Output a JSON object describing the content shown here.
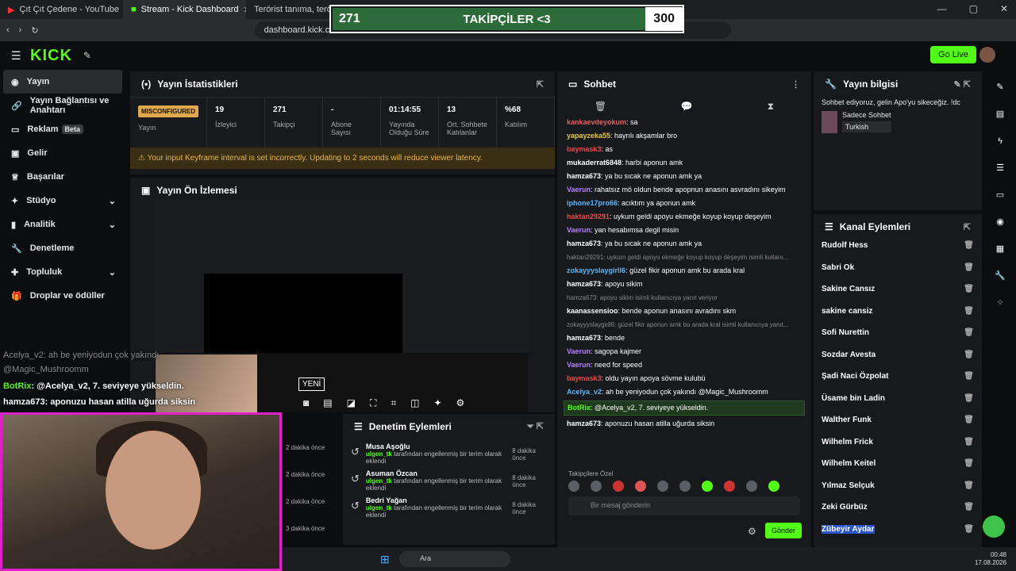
{
  "browser": {
    "tabs": [
      {
        "title": "Çıt Çıt Çedene - YouTube"
      },
      {
        "title": "Stream - Kick Dashboard"
      },
      {
        "title": "Terörist tanıma, terörist ta..."
      }
    ],
    "url": "dashboard.kick.com/str"
  },
  "overlay": {
    "current": "271",
    "label": "TAKİPÇİLER <3",
    "goal": "300",
    "progress": 0.9033
  },
  "header": {
    "logo": "KICK",
    "go_live": "Go Live"
  },
  "sidebar": {
    "items": [
      {
        "label": "Yayın"
      },
      {
        "label": "Yayın Bağlantısı ve Anahtarı"
      },
      {
        "label": "Reklam"
      },
      {
        "label": "Gelir"
      },
      {
        "label": "Başarılar"
      },
      {
        "label": "Stüdyo"
      },
      {
        "label": "Analitik"
      },
      {
        "label": "Denetleme"
      },
      {
        "label": "Topluluk"
      },
      {
        "label": "Droplar ve ödüller"
      }
    ],
    "beta": "Beta"
  },
  "stats": {
    "title": "Yayın İstatistikleri",
    "status": "MISCONFIGURED",
    "status_label": "Yayın",
    "cells": [
      {
        "value": "19",
        "label": "İzleyici"
      },
      {
        "value": "271",
        "label": "Takipçi"
      },
      {
        "value": "-",
        "label": "Abone Sayısı"
      },
      {
        "value": "01:14:55",
        "label": "Yayında Olduğu Süre"
      },
      {
        "value": "13",
        "label": "Ort. Sohbete Katılanlar"
      },
      {
        "value": "%68",
        "label": "Katılım"
      }
    ],
    "warning": "Your input Keyframe interval is set incorrectly. Updating to 2 seconds will reduce viewer latency."
  },
  "preview": {
    "title": "Yayın Ön İzlemesi",
    "new_badge": "YENİ"
  },
  "overlay_chat": [
    {
      "user": "Acelya_v2",
      "text": ": ah be yeniyodun çok yakındı"
    },
    {
      "user": "",
      "text": "@Magic_Mushroomm"
    },
    {
      "user": "BotRix",
      "text": ": @Acelya_v2, 7. seviyeye yükseldin."
    },
    {
      "user": "hamza673",
      "text": ": aponuzu hasan atilla uğurda siksin"
    }
  ],
  "audit": {
    "title": "Denetim Eylemleri",
    "times_left": [
      "2 dakika önce",
      "2 dakika önce",
      "2 dakika önce",
      "3 dakika önce"
    ],
    "rows": [
      {
        "name": "Musa Aşoğlu",
        "by": "ulgen_tk",
        "action": "tarafından engellenmiş bir terim olarak eklendi",
        "time": "8 dakika önce"
      },
      {
        "name": "Asuman Özcan",
        "by": "ulgen_tk",
        "action": "tarafından engellenmiş bir terim olarak eklendi",
        "time": "8 dakika önce"
      },
      {
        "name": "Bedri Yağan",
        "by": "ulgen_tk",
        "action": "tarafından engellenmiş bir terim olarak eklendi",
        "time": "8 dakika önce"
      }
    ]
  },
  "chat": {
    "title": "Sohbet",
    "messages": [
      {
        "user": "kankaevdeyokum",
        "color": "#e86060",
        "text": ": sa"
      },
      {
        "user": "yapayzeka55",
        "color": "#e8c84a",
        "text": ": hayrılı akşamlar bro"
      },
      {
        "user": "baymask3",
        "color": "#e84a4a",
        "text": ": as"
      },
      {
        "user": "mukaderrat6848",
        "color": "#ffffff",
        "text": ": harbi aponun amk"
      },
      {
        "user": "hamza673",
        "color": "#ffffff",
        "text": ": ya bu sıcak ne aponun amk ya"
      },
      {
        "user": "Vaerun",
        "color": "#b580ff",
        "text": ": rahatsız mö oldun bende apopnun anasını asvradını sikeyim"
      },
      {
        "user": "iphone17pro66",
        "color": "#5ab8ff",
        "text": ": acıktım ya aponun amk"
      },
      {
        "user": "haktan29291",
        "color": "#e84a4a",
        "text": ": uykum geldi apoyu ekmeğe koyup koyup deşeyim"
      },
      {
        "user": "Vaerun",
        "color": "#b580ff",
        "text": ": yan hesabımsa degil misin"
      },
      {
        "user": "hamza673",
        "color": "#ffffff",
        "text": ": ya bu sıcak ne aponun amk ya"
      },
      {
        "user": "zokayyyslaygirll6",
        "color": "#5ab8ff",
        "text": ": güzel fikir aponun amk bu arada kral",
        "reply": "haktan29291: uykum geldi apoyu ekmeğe koyup koyup deşeyim isimli kullanı..."
      },
      {
        "user": "hamza673",
        "color": "#ffffff",
        "text": ": apoyu sikim"
      },
      {
        "user": "kaanassensioo",
        "color": "#ffffff",
        "text": ": bende aponun anasını avradını skm",
        "reply": "hamza673: apoyu sikim isimli kullanıcıya yanıt veriyor"
      },
      {
        "user": "hamza673",
        "color": "#ffffff",
        "text": ": bende",
        "reply": "zokayyyslaygirll6: güzel fikir aponun amk bu arada kral isimli kullanıcıya yanıt..."
      },
      {
        "user": "Vaerun",
        "color": "#b580ff",
        "text": ": sagopa kajmer"
      },
      {
        "user": "Vaerun",
        "color": "#b580ff",
        "text": ": need for speed"
      },
      {
        "user": "baymask3",
        "color": "#e84a4a",
        "text": ": oldu yayın apoya sövme kulubü"
      },
      {
        "user": "Acelya_v2",
        "color": "#5ab8ff",
        "text": ": ah be yeniyodun çok yakındı @Magic_Mushroomm"
      },
      {
        "user": "BotRix",
        "color": "#53fc18",
        "text": ": @Acelya_v2, 7. seviyeye yükseldin."
      },
      {
        "user": "hamza673",
        "color": "#ffffff",
        "text": ": aponuzu hasan atilla uğurda siksin"
      }
    ],
    "emote_label": "Takipçilere Özel",
    "placeholder": "Bir mesaj gönderin",
    "send": "Gönder"
  },
  "stream_info": {
    "title": "Yayın bilgisi",
    "stream_title": "Sohbet ediyoruz, gelin Apo'yu sikeceğiz. !dc",
    "category": "Sadece Sohbet",
    "language": "Turkish"
  },
  "channel_actions": {
    "title": "Kanal Eylemleri",
    "items": [
      "Rudolf Hess",
      "Sabri Ok",
      "Sakine Cansız",
      "sakine cansiz",
      "Sofi Nurettin",
      "Sozdar Avesta",
      "Şadi Naci Özpolat",
      "Üsame bin Ladin",
      "Walther Funk",
      "Wilhelm Frick",
      "Wilhelm Keitel",
      "Yılmaz Selçuk",
      "Zeki Gürbüz",
      "Zübeyir Aydar"
    ]
  },
  "taskbar": {
    "search": "Ara",
    "time": "00:48",
    "date": "17.08.2026"
  }
}
